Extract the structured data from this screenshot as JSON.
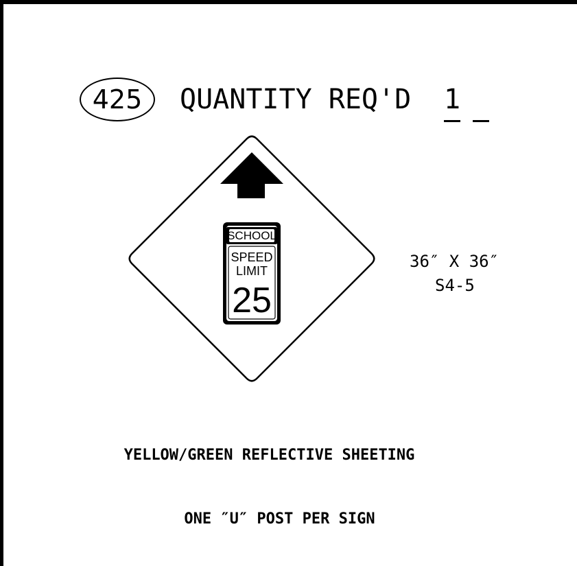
{
  "header": {
    "item_number": "425",
    "quantity_label": "QUANTITY REQ'D",
    "quantity_value": "1"
  },
  "sign": {
    "school_label": "SCHOOL",
    "speed_label": "SPEED",
    "limit_label": "LIMIT",
    "speed_value": "25",
    "size": "36″ X 36″",
    "code": "S4-5"
  },
  "notes": {
    "sheeting": "YELLOW/GREEN REFLECTIVE SHEETING",
    "post": "ONE ″U″ POST PER SIGN"
  }
}
